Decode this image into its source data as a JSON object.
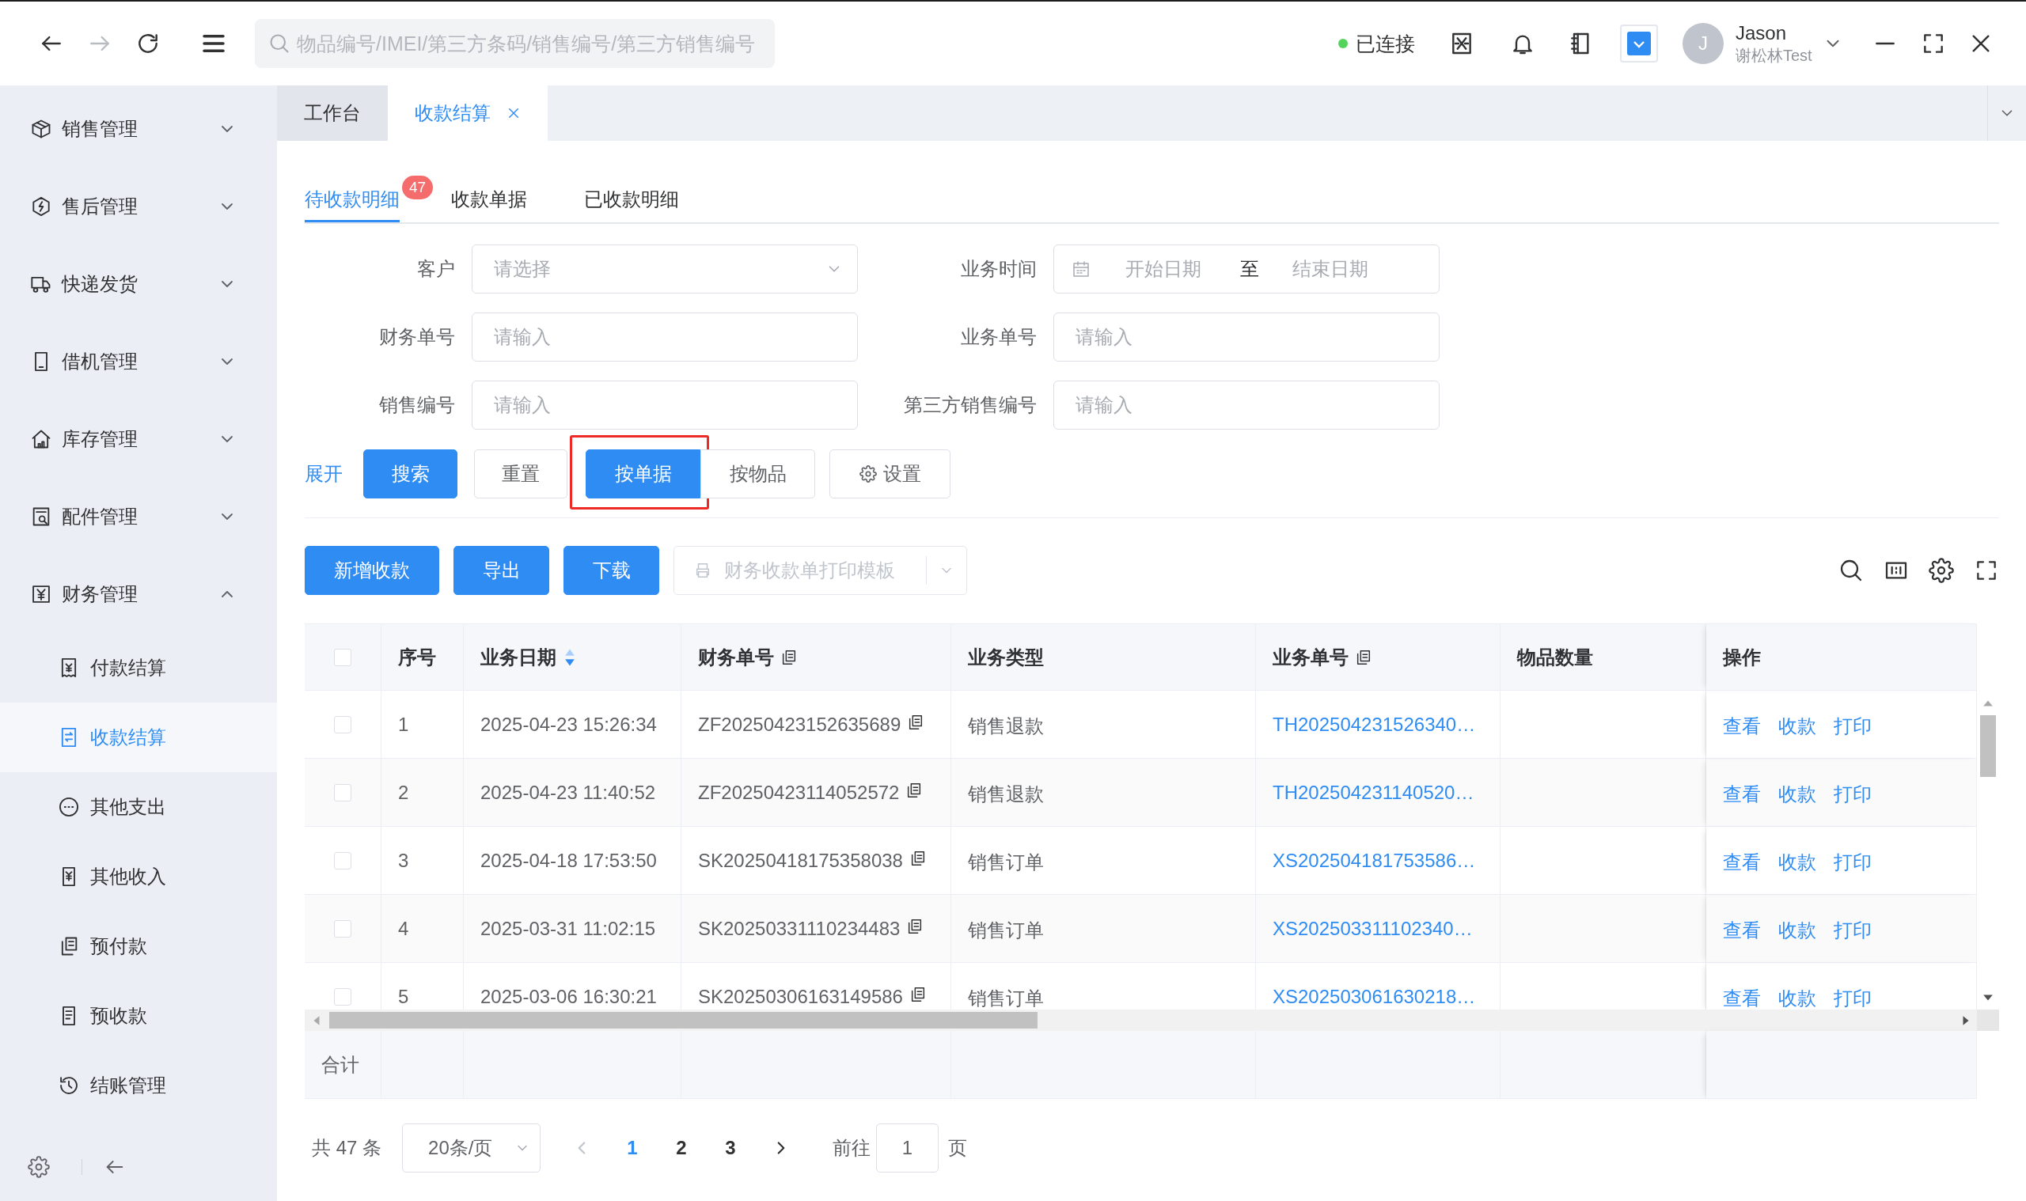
{
  "top_bar": {
    "nav": [
      {
        "kind": "back",
        "disabled": false
      },
      {
        "kind": "forward",
        "disabled": true
      },
      {
        "kind": "refresh",
        "disabled": false
      }
    ],
    "search": {
      "placeholder": "物品编号/IMEI/第三方条码/销售编号/第三方销售编号"
    },
    "connection": {
      "label": "已连接",
      "connected": true
    },
    "user": {
      "initial": "J",
      "name": "Jason",
      "subtitle": "谢松林Test"
    }
  },
  "sidebar": {
    "items": [
      {
        "label": "销售管理",
        "expanded": false
      },
      {
        "label": "售后管理",
        "expanded": false
      },
      {
        "label": "快递发货",
        "expanded": false
      },
      {
        "label": "借机管理",
        "expanded": false
      },
      {
        "label": "库存管理",
        "expanded": false
      },
      {
        "label": "配件管理",
        "expanded": false
      },
      {
        "label": "财务管理",
        "expanded": true,
        "children": [
          {
            "label": "付款结算",
            "selected": false
          },
          {
            "label": "收款结算",
            "selected": true
          },
          {
            "label": "其他支出",
            "selected": false
          },
          {
            "label": "其他收入",
            "selected": false
          },
          {
            "label": "预付款",
            "selected": false
          },
          {
            "label": "预收款",
            "selected": false
          },
          {
            "label": "结账管理",
            "selected": false
          }
        ]
      }
    ]
  },
  "page_tabs": [
    {
      "label": "工作台",
      "selected": false,
      "closable": false
    },
    {
      "label": "收款结算",
      "selected": true,
      "closable": true
    }
  ],
  "sub_tabs": [
    {
      "label": "待收款明细",
      "selected": true,
      "badge": "47"
    },
    {
      "label": "收款单据",
      "selected": false
    },
    {
      "label": "已收款明细",
      "selected": false
    }
  ],
  "filters": [
    {
      "kind": "select",
      "label": "客户",
      "placeholder": "请选择"
    },
    {
      "kind": "daterange",
      "label": "业务时间",
      "start_placeholder": "开始日期",
      "separator": "至",
      "end_placeholder": "结束日期"
    },
    {
      "kind": "input",
      "label": "财务单号",
      "placeholder": "请输入"
    },
    {
      "kind": "input",
      "label": "业务单号",
      "placeholder": "请输入"
    },
    {
      "kind": "input",
      "label": "销售编号",
      "placeholder": "请输入"
    },
    {
      "kind": "input",
      "label": "第三方销售编号",
      "placeholder": "请输入"
    }
  ],
  "filter_actions": {
    "expand_link": "展开",
    "search_button": "搜索",
    "reset_button": "重置",
    "view_toggle": [
      {
        "label": "按单据",
        "selected": true,
        "highlighted": true
      },
      {
        "label": "按物品",
        "selected": false,
        "highlighted": false
      }
    ],
    "settings_button": "设置"
  },
  "table_toolbar": {
    "buttons": [
      "新增收款",
      "导出",
      "下载"
    ],
    "print_template": {
      "label": "财务收款单打印模板",
      "disabled": true
    }
  },
  "table": {
    "select_all": {
      "checked": false
    },
    "columns": [
      {
        "label": "序号"
      },
      {
        "label": "业务日期",
        "sortable": true
      },
      {
        "label": "财务单号",
        "copy_icon": true
      },
      {
        "label": "业务类型"
      },
      {
        "label": "业务单号",
        "copy_icon": true,
        "link": true
      },
      {
        "label": "物品数量"
      },
      {
        "label": "操作"
      }
    ],
    "rows": [
      {
        "selected": false,
        "index": "1",
        "date": "2025-04-23 15:26:34",
        "finance_no": "ZF20250423152635689",
        "type": "销售退款",
        "business_no": "TH202504231526340…",
        "actions": [
          "查看",
          "收款",
          "打印"
        ]
      },
      {
        "selected": false,
        "index": "2",
        "date": "2025-04-23 11:40:52",
        "finance_no": "ZF20250423114052572",
        "type": "销售退款",
        "business_no": "TH202504231140520…",
        "actions": [
          "查看",
          "收款",
          "打印"
        ]
      },
      {
        "selected": false,
        "index": "3",
        "date": "2025-04-18 17:53:50",
        "finance_no": "SK20250418175358038",
        "type": "销售订单",
        "business_no": "XS202504181753586…",
        "actions": [
          "查看",
          "收款",
          "打印"
        ]
      },
      {
        "selected": false,
        "index": "4",
        "date": "2025-03-31 11:02:15",
        "finance_no": "SK20250331110234483",
        "type": "销售订单",
        "business_no": "XS202503311102340…",
        "actions": [
          "查看",
          "收款",
          "打印"
        ]
      },
      {
        "selected": false,
        "index": "5",
        "date": "2025-03-06 16:30:21",
        "finance_no": "SK20250306163149586",
        "type": "销售订单",
        "business_no": "XS202503061630218…",
        "actions": [
          "查看",
          "收款",
          "打印"
        ]
      }
    ],
    "footer": {
      "label": "合计"
    }
  },
  "pagination": {
    "total": "共 47 条",
    "page_size": "20条/页",
    "prev": {
      "disabled": true
    },
    "pages": [
      {
        "label": "1",
        "selected": true
      },
      {
        "label": "2",
        "selected": false
      },
      {
        "label": "3",
        "selected": false
      }
    ],
    "next": {
      "disabled": false
    },
    "jump_label": "前往",
    "jump_value": "1",
    "jump_suffix": "页"
  }
}
